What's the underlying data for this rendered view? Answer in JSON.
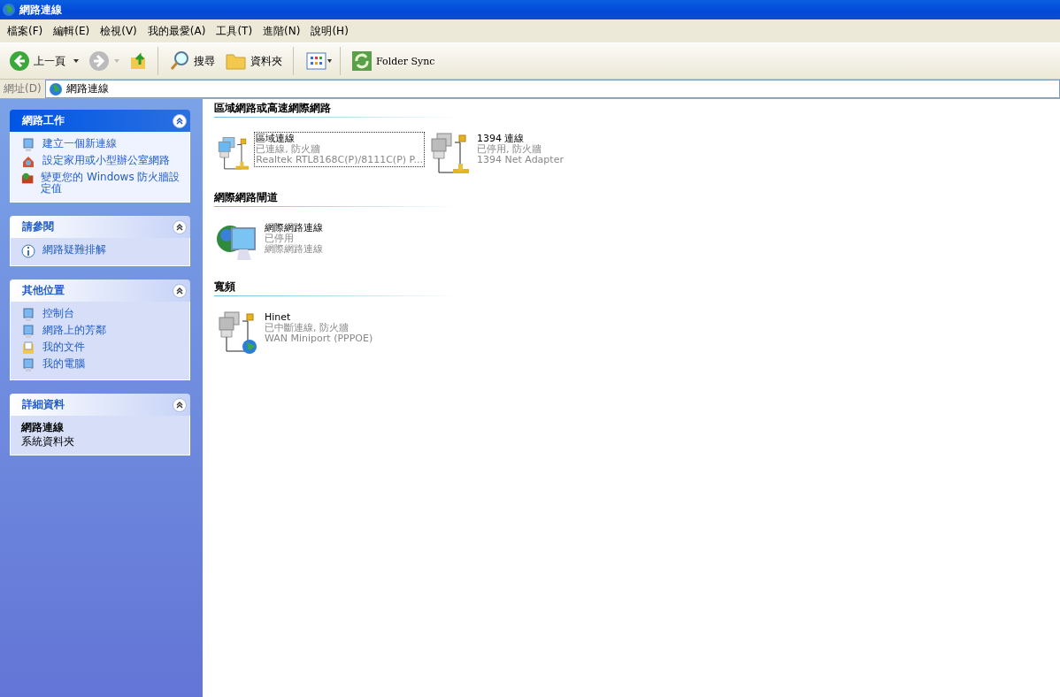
{
  "window": {
    "title": "網路連線"
  },
  "menu": [
    "檔案(F)",
    "編輯(E)",
    "檢視(V)",
    "我的最愛(A)",
    "工具(T)",
    "進階(N)",
    "說明(H)"
  ],
  "toolbar": {
    "back": "上一頁",
    "search": "搜尋",
    "folders": "資料夾",
    "folder_sync": "Folder Sync"
  },
  "address": {
    "label": "網址(D)",
    "value": "網路連線"
  },
  "sidebar": [
    {
      "kind": "links",
      "title": "網路工作",
      "special": true,
      "items": [
        "建立一個新連線",
        "設定家用或小型辦公室網路",
        "變更您的 Windows 防火牆設定值"
      ]
    },
    {
      "kind": "links",
      "title": "請參閱",
      "special": false,
      "items": [
        "網路疑難排解"
      ]
    },
    {
      "kind": "links",
      "title": "其他位置",
      "special": false,
      "items": [
        "控制台",
        "網路上的芳鄰",
        "我的文件",
        "我的電腦"
      ]
    },
    {
      "kind": "details",
      "title": "詳細資料",
      "special": false,
      "name": "網路連線",
      "subtitle": "系統資料夾"
    }
  ],
  "groups": [
    {
      "title": "區域網路或高速網際網路",
      "items": [
        {
          "kind": "lan",
          "active": true,
          "selected": true,
          "name": "區域連線",
          "status": "已連線, 防火牆",
          "device": "Realtek RTL8168C(P)/8111C(P) P..."
        },
        {
          "kind": "lan",
          "active": false,
          "selected": false,
          "name": "1394 連線",
          "status": "已停用, 防火牆",
          "device": "1394 Net Adapter"
        }
      ]
    },
    {
      "title": "網際網路閘道",
      "items": [
        {
          "kind": "gateway",
          "active": true,
          "selected": false,
          "name": "網際網路連線",
          "status": "已停用",
          "device": "網際網路連線"
        }
      ]
    },
    {
      "title": "寬頻",
      "items": [
        {
          "kind": "broadband",
          "active": false,
          "selected": false,
          "name": "Hinet",
          "status": "已中斷連線, 防火牆",
          "device": "WAN Miniport (PPPOE)"
        }
      ]
    }
  ]
}
